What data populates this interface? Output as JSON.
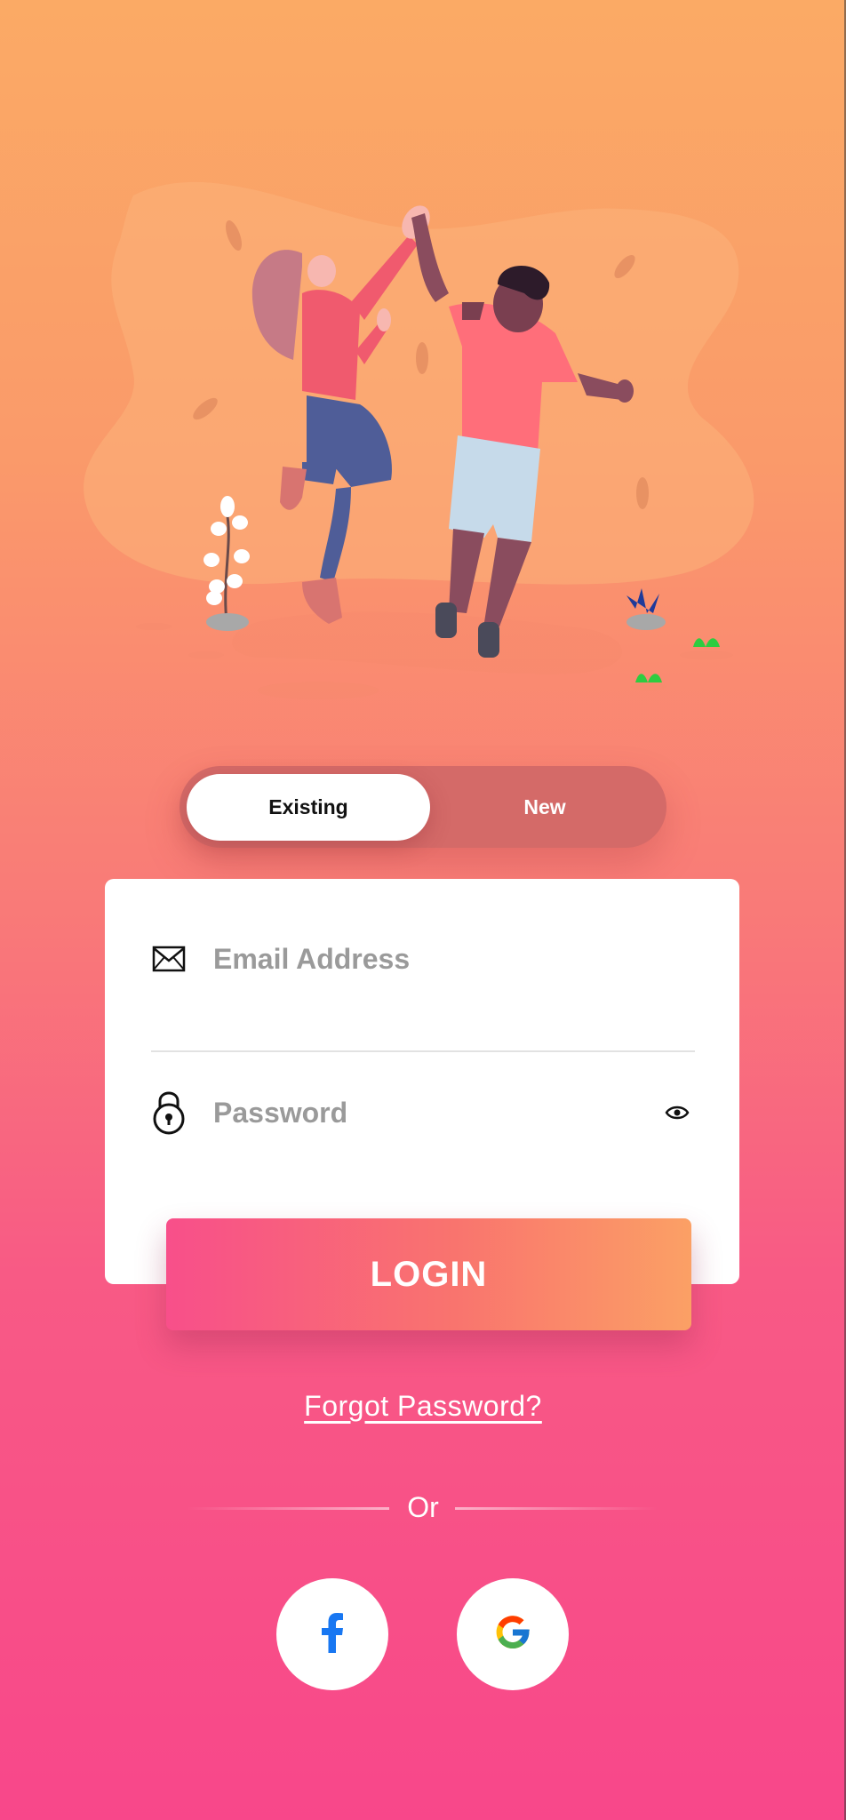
{
  "auth_toggle": {
    "existing_label": "Existing",
    "new_label": "New",
    "selected": "Existing"
  },
  "form": {
    "email": {
      "placeholder": "Email Address",
      "value": "",
      "icon": "envelope-icon"
    },
    "password": {
      "placeholder": "Password",
      "value": "",
      "icon": "padlock-icon",
      "toggle_icon": "eye-icon"
    }
  },
  "login_button": {
    "label": "LOGIN"
  },
  "forgot_password": {
    "label": "Forgot Password?"
  },
  "divider": {
    "label": "Or"
  },
  "social_login": [
    {
      "name": "facebook",
      "icon": "facebook-icon",
      "color": "#1877f2"
    },
    {
      "name": "google",
      "icon": "google-icon"
    }
  ],
  "colors": {
    "background_top": "#fbaa65",
    "background_bottom": "#f8478a",
    "toggle_track": "#d46a68",
    "button_gradient_start": "#f84f8a",
    "button_gradient_end": "#fba065"
  }
}
